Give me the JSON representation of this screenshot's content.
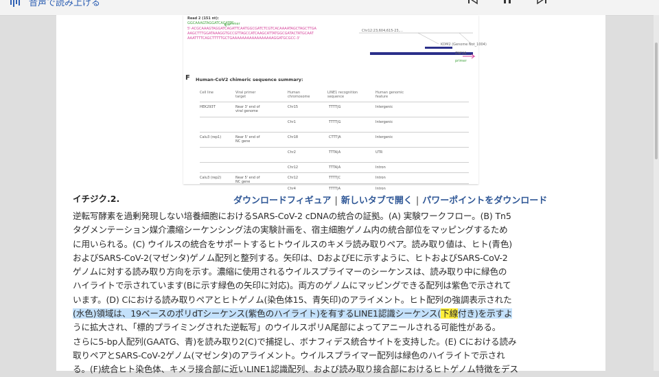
{
  "toolbar": {
    "read_aloud_label": "音声で読み上げる",
    "read_aloud_icon": "read-aloud-icon",
    "media": [
      "previous-icon",
      "pause-icon",
      "next-icon"
    ]
  },
  "figure": {
    "read_title": "Read 2 (151 nt):",
    "primer_label": "primer",
    "seq_top": "GGCAAAGTAGGATCAGATTC",
    "seq_lines": [
      "5'-ACGCAAAGTAGGATCAGATTCAATGGCGATCTCGTCACAAAATAGCTAGCTTGA",
      "AAGCTTTGGATAAAGGTGCCGTTAGCCATCAAGCATTATGGCGATACTATGCAAT",
      "AAATTTTCAGCTTTTTGCTGAAAAAAAAAAAAAAAAAGGATGCGCC-3'"
    ],
    "track_labels": [
      "Chr12:23,604,615-23,...",
      "ZNF26",
      "KDM2 (Genome Not_1004)"
    ],
    "panel_f_label": "F",
    "summary_title": "Human-CoV2 chimeric sequence summary:",
    "columns": [
      "Cell line",
      "Viral primer target",
      "Human chromosome",
      "LINE1 recognition sequence",
      "Human genomic feature"
    ],
    "rows": [
      {
        "cell": "HEK293T",
        "primer": "Near 3' end of",
        "primer2": "viral genome",
        "chr": "Chr15",
        "seq": "TTTT|G",
        "feature": "Intergenic"
      },
      {
        "cell": "",
        "primer": "",
        "primer2": "",
        "chr": "Chr1",
        "seq": "TTTT|G",
        "feature": "Intergenic"
      },
      {
        "cell": "Calu3 (rep1)",
        "primer": "Near 5' end of",
        "primer2": "NC gene",
        "chr": "Chr18",
        "seq": "CTTT|A",
        "feature": "Intergenic"
      },
      {
        "cell": "",
        "primer": "",
        "primer2": "",
        "chr": "Chr2",
        "seq": "TTTA|A",
        "feature": "UTR"
      },
      {
        "cell": "",
        "primer": "",
        "primer2": "",
        "chr": "Chr12",
        "seq": "TTTA|A",
        "feature": "Intron"
      },
      {
        "cell": "Calu3 (rep2)",
        "primer": "Near 5' end of",
        "primer2": "NC gene",
        "chr": "Chr12",
        "seq": "TTTT|C",
        "feature": "Intron"
      },
      {
        "cell": "",
        "primer": "",
        "primer2": "",
        "chr": "Chr4",
        "seq": "TTTT|A",
        "feature": "Intron"
      }
    ]
  },
  "caption_header": {
    "label": "イチジク.2.",
    "links": [
      "ダウンロードフィギュア",
      "新しいタブで開く",
      "パワーポイントをダウンロード"
    ]
  },
  "caption": {
    "l1": "逆転写酵素を過剰発現しない培養細胞におけるSARS-CoV-2 cDNAの統合の証拠。(A) 実験ワークフロー。(B) Tn5",
    "l2": "タグメンテーション媒介濃縮シーケンシング法の実験計画を、宿主細胞ゲノム内の統合部位をマッピングするため",
    "l3": "に用いられる。(C) ウイルスの統合をサポートするヒトウイルスのキメラ読み取りペア。読み取り値は、ヒト(青色)",
    "l4": "およびSARS-CoV-2(マゼンタ)ゲノム配列と整列する。矢印は、DおよびEに示すように、ヒトおよびSARS-CoV-2",
    "l5": "ゲノムに対する読み取り方向を示す。濃縮に使用されるウイルスプライマーのシーケンスは、読み取り中に緑色の",
    "l6": "ハイライトで示されています(Bに示す緑色の矢印に対応)。両方のゲノムにマッピングできる配列は紫色で示されて",
    "l7": "います。(D) Cにおける読み取りペアとヒトゲノム(染色体15、青矢印)のアライメント。ヒト配列の強調表示された",
    "l8_a": "(水色)領域は、19ベースのポリdTシーケンス(紫色のハイライト)を有するLINE1認識シーケンス(",
    "l8_b": "下線",
    "l8_c": "付き)を示すよ",
    "l9": "うに拡大され、「標的プライミングされた逆転写」のウイルスポリA尾部によってアニールされる可能性がある。",
    "l10": "さらに5-bp人配列(GAATG、青)を読み取り2(C)で捕捉し、ボナフィデス統合サイトを支持した。(E) Cにおける読み",
    "l11": "取りペアとSARS-CoV-2ゲノム(マゼンタ)のアライメント。ウイルスプライマー配列は緑色のハイライトで示され",
    "l12": "る。(F)統合ヒト染色体、キメラ接合部に近いLINE1認識配列、および読み取り接合部におけるヒトゲノム特徴をデス"
  },
  "colors": {
    "link": "#2f5796",
    "highlight_blue": "#c4e1fb",
    "highlight_yellow": "#ffef3a",
    "magenta_seq": "#d5439a",
    "green_primer": "#41a33d",
    "track_blue": "#2b2f8a"
  }
}
